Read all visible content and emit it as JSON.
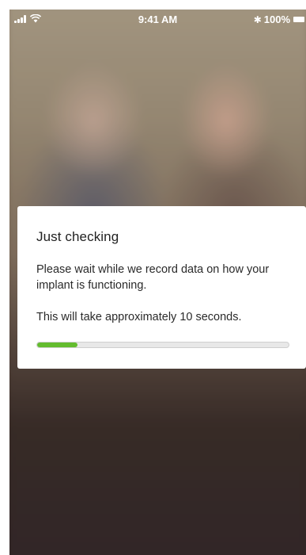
{
  "status_bar": {
    "time": "9:41 AM",
    "battery": "100%",
    "bluetooth_icon": "bluetooth-icon",
    "signal_icon": "signal-bars-icon",
    "wifi_icon": "wifi-icon",
    "battery_icon": "battery-icon"
  },
  "dialog": {
    "title": "Just checking",
    "message": "Please wait while we record data on how your implant is functioning.",
    "duration_note": "This will take approximately 10 seconds.",
    "progress": 0.16
  },
  "colors": {
    "progress_fill": "#63bc2e",
    "progress_track": "#e8e8e8",
    "card_background": "#ffffff",
    "backdrop_dark": "#3a2e29"
  }
}
